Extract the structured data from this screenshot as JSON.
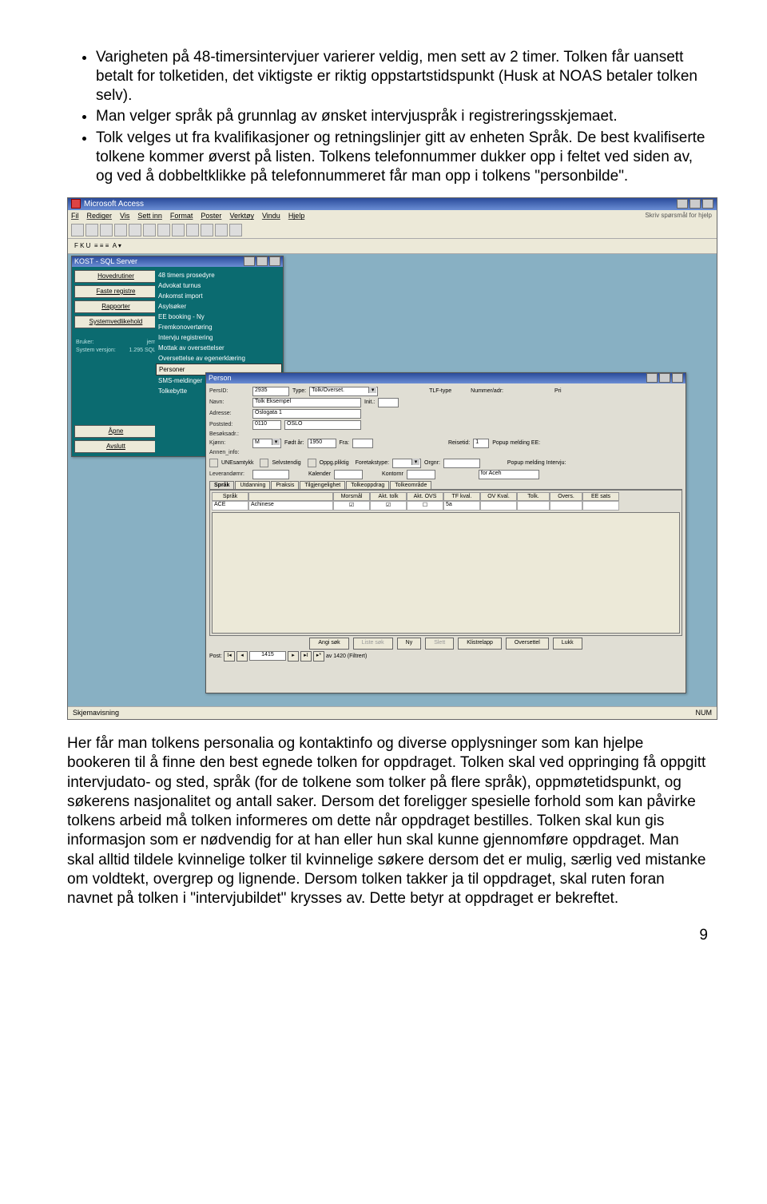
{
  "bullets": [
    "Varigheten på 48-timersintervjuer varierer veldig, men sett av 2 timer. Tolken får uansett betalt for tolketiden, det viktigste er riktig oppstartstidspunkt (Husk at NOAS betaler tolken selv).",
    "Man velger språk på grunnlag av ønsket intervjuspråk i registreringsskjemaet.",
    "Tolk velges ut fra kvalifikasjoner og retningslinjer gitt av enheten Språk. De best kvalifiserte tolkene kommer øverst på listen. Tolkens telefonnummer dukker opp i feltet ved siden av, og ved å dobbeltklikke på telefonnummeret får man opp i tolkens \"personbilde\"."
  ],
  "app_title": "Microsoft Access",
  "menu": [
    "Fil",
    "Rediger",
    "Vis",
    "Sett inn",
    "Format",
    "Poster",
    "Verktøy",
    "Vindu",
    "Hjelp"
  ],
  "help_ph": "Skriv spørsmål for hjelp",
  "fmtbar": "F  K  U",
  "kost_title": "KOST - SQL Server",
  "side_btns": [
    "Hovedrutiner",
    "Faste registre",
    "Rapporter",
    "Systemvedlikehold"
  ],
  "side_info1a": "Bruker:",
  "side_info1b": "jem",
  "side_info2a": "System versjon:",
  "side_info2b": "1.295 SQL",
  "side_apne": "Åpne",
  "side_avslutt": "Avslutt",
  "teal_items": [
    "48 timers prosedyre",
    "Advokat turnus",
    "Ankomst import",
    "Asylsøker",
    "EE booking - Ny",
    "Fremkonovertøring",
    "Intervju registrering",
    "Mottak av oversettelser",
    "Oversettelse av egenerklæring",
    "Personer",
    "SMS-meldinger",
    "Tolkebytte"
  ],
  "person_title": "Person",
  "labels": {
    "persid": "PersID:",
    "type": "Type:",
    "navn": "Navn:",
    "init": "Init.:",
    "adr": "Adresse:",
    "post": "Poststed:",
    "besok": "Besøksadr.:",
    "kjonn": "Kjønn:",
    "fodt": "Født år:",
    "fra": "Fra:",
    "reisetid": "Reisetid:",
    "popup": "Popup melding EE:",
    "annen": "Annen_info:",
    "une": "UNEsamtykk",
    "selvst": "Selvstendig",
    "oppg": "Oppg.pliktig",
    "foretak": "Foretakstype:",
    "orgnr": "Orgnr:",
    "popup2": "Popup melding Intervju:",
    "lev": "Leverandørnr:",
    "kal": "Kalender",
    "kontor": "Kontornr",
    "tlftype": "TLF-type",
    "numadr": "Nummer/adr:",
    "pri": "Pri",
    "sok": "Angi søk",
    "liste": "Liste søk",
    "ny": "Ny",
    "slett": "Slett",
    "klistre": "Klistrelapp",
    "overs": "Oversettel",
    "lukk": "Lukk",
    "post_lbl": "Post:",
    "nav_count": "av 1420 (Filtrert)",
    "nav_pos": "1415",
    "aceh": "for Aceh"
  },
  "values": {
    "persid": "2935",
    "type": "Tolk/Overset.",
    "navn": "Tolk Eksempel",
    "adr": "Oslogata 1",
    "post_nr": "0110",
    "post_city": "OSLO",
    "kjonn": "M",
    "fodt": "1950",
    "reisetid": "1"
  },
  "tabs": [
    "Språk",
    "Utdanning",
    "Praksis",
    "Tilgjengelighet",
    "Tolkeoppdrag",
    "Tolkeområde"
  ],
  "grid_headers": [
    "Språk",
    "",
    "Morsmål",
    "Akt. tolk",
    "Akt. OVS",
    "TF kval.",
    "OV Kval.",
    "Tolk.",
    "Overs.",
    "EE sats"
  ],
  "grid_row": [
    "ACE",
    "Achinese",
    "",
    "",
    "",
    "5a",
    "",
    "",
    "",
    ""
  ],
  "status_left": "Skjemavisning",
  "status_right": "NUM",
  "para2": "Her får man tolkens personalia og kontaktinfo og diverse opplysninger som kan hjelpe bookeren til å finne den best egnede tolken for oppdraget. Tolken skal ved oppringing få oppgitt intervjudato- og sted, språk (for de tolkene som tolker på flere språk), oppmøtetidspunkt, og søkerens nasjonalitet og antall saker. Dersom det foreligger spesielle forhold som kan påvirke tolkens arbeid må tolken informeres om dette når oppdraget bestilles. Tolken skal kun gis informasjon som er nødvendig for at han eller hun skal kunne gjennomføre oppdraget.  Man skal alltid tildele kvinnelige tolker til kvinnelige søkere dersom det er mulig, særlig ved mistanke om voldtekt, overgrep og lignende. Dersom tolken takker ja til oppdraget, skal ruten foran navnet på tolken i \"intervjubildet\" krysses av. Dette betyr at oppdraget er bekreftet.",
  "page_num": "9"
}
